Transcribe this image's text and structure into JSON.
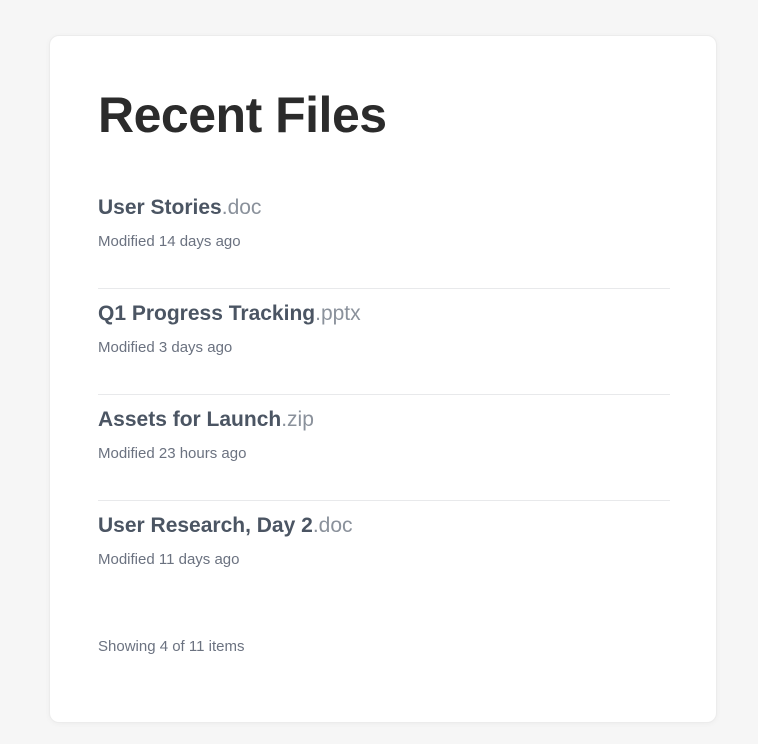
{
  "title": "Recent Files",
  "files": [
    {
      "name": "User Stories",
      "ext": ".doc",
      "modified": "Modified 14 days ago"
    },
    {
      "name": "Q1 Progress Tracking",
      "ext": ".pptx",
      "modified": "Modified 3 days ago"
    },
    {
      "name": "Assets for Launch",
      "ext": ".zip",
      "modified": "Modified 23 hours ago"
    },
    {
      "name": "User Research, Day 2",
      "ext": ".doc",
      "modified": "Modified 11 days ago"
    }
  ],
  "footer": "Showing 4 of 11 items"
}
